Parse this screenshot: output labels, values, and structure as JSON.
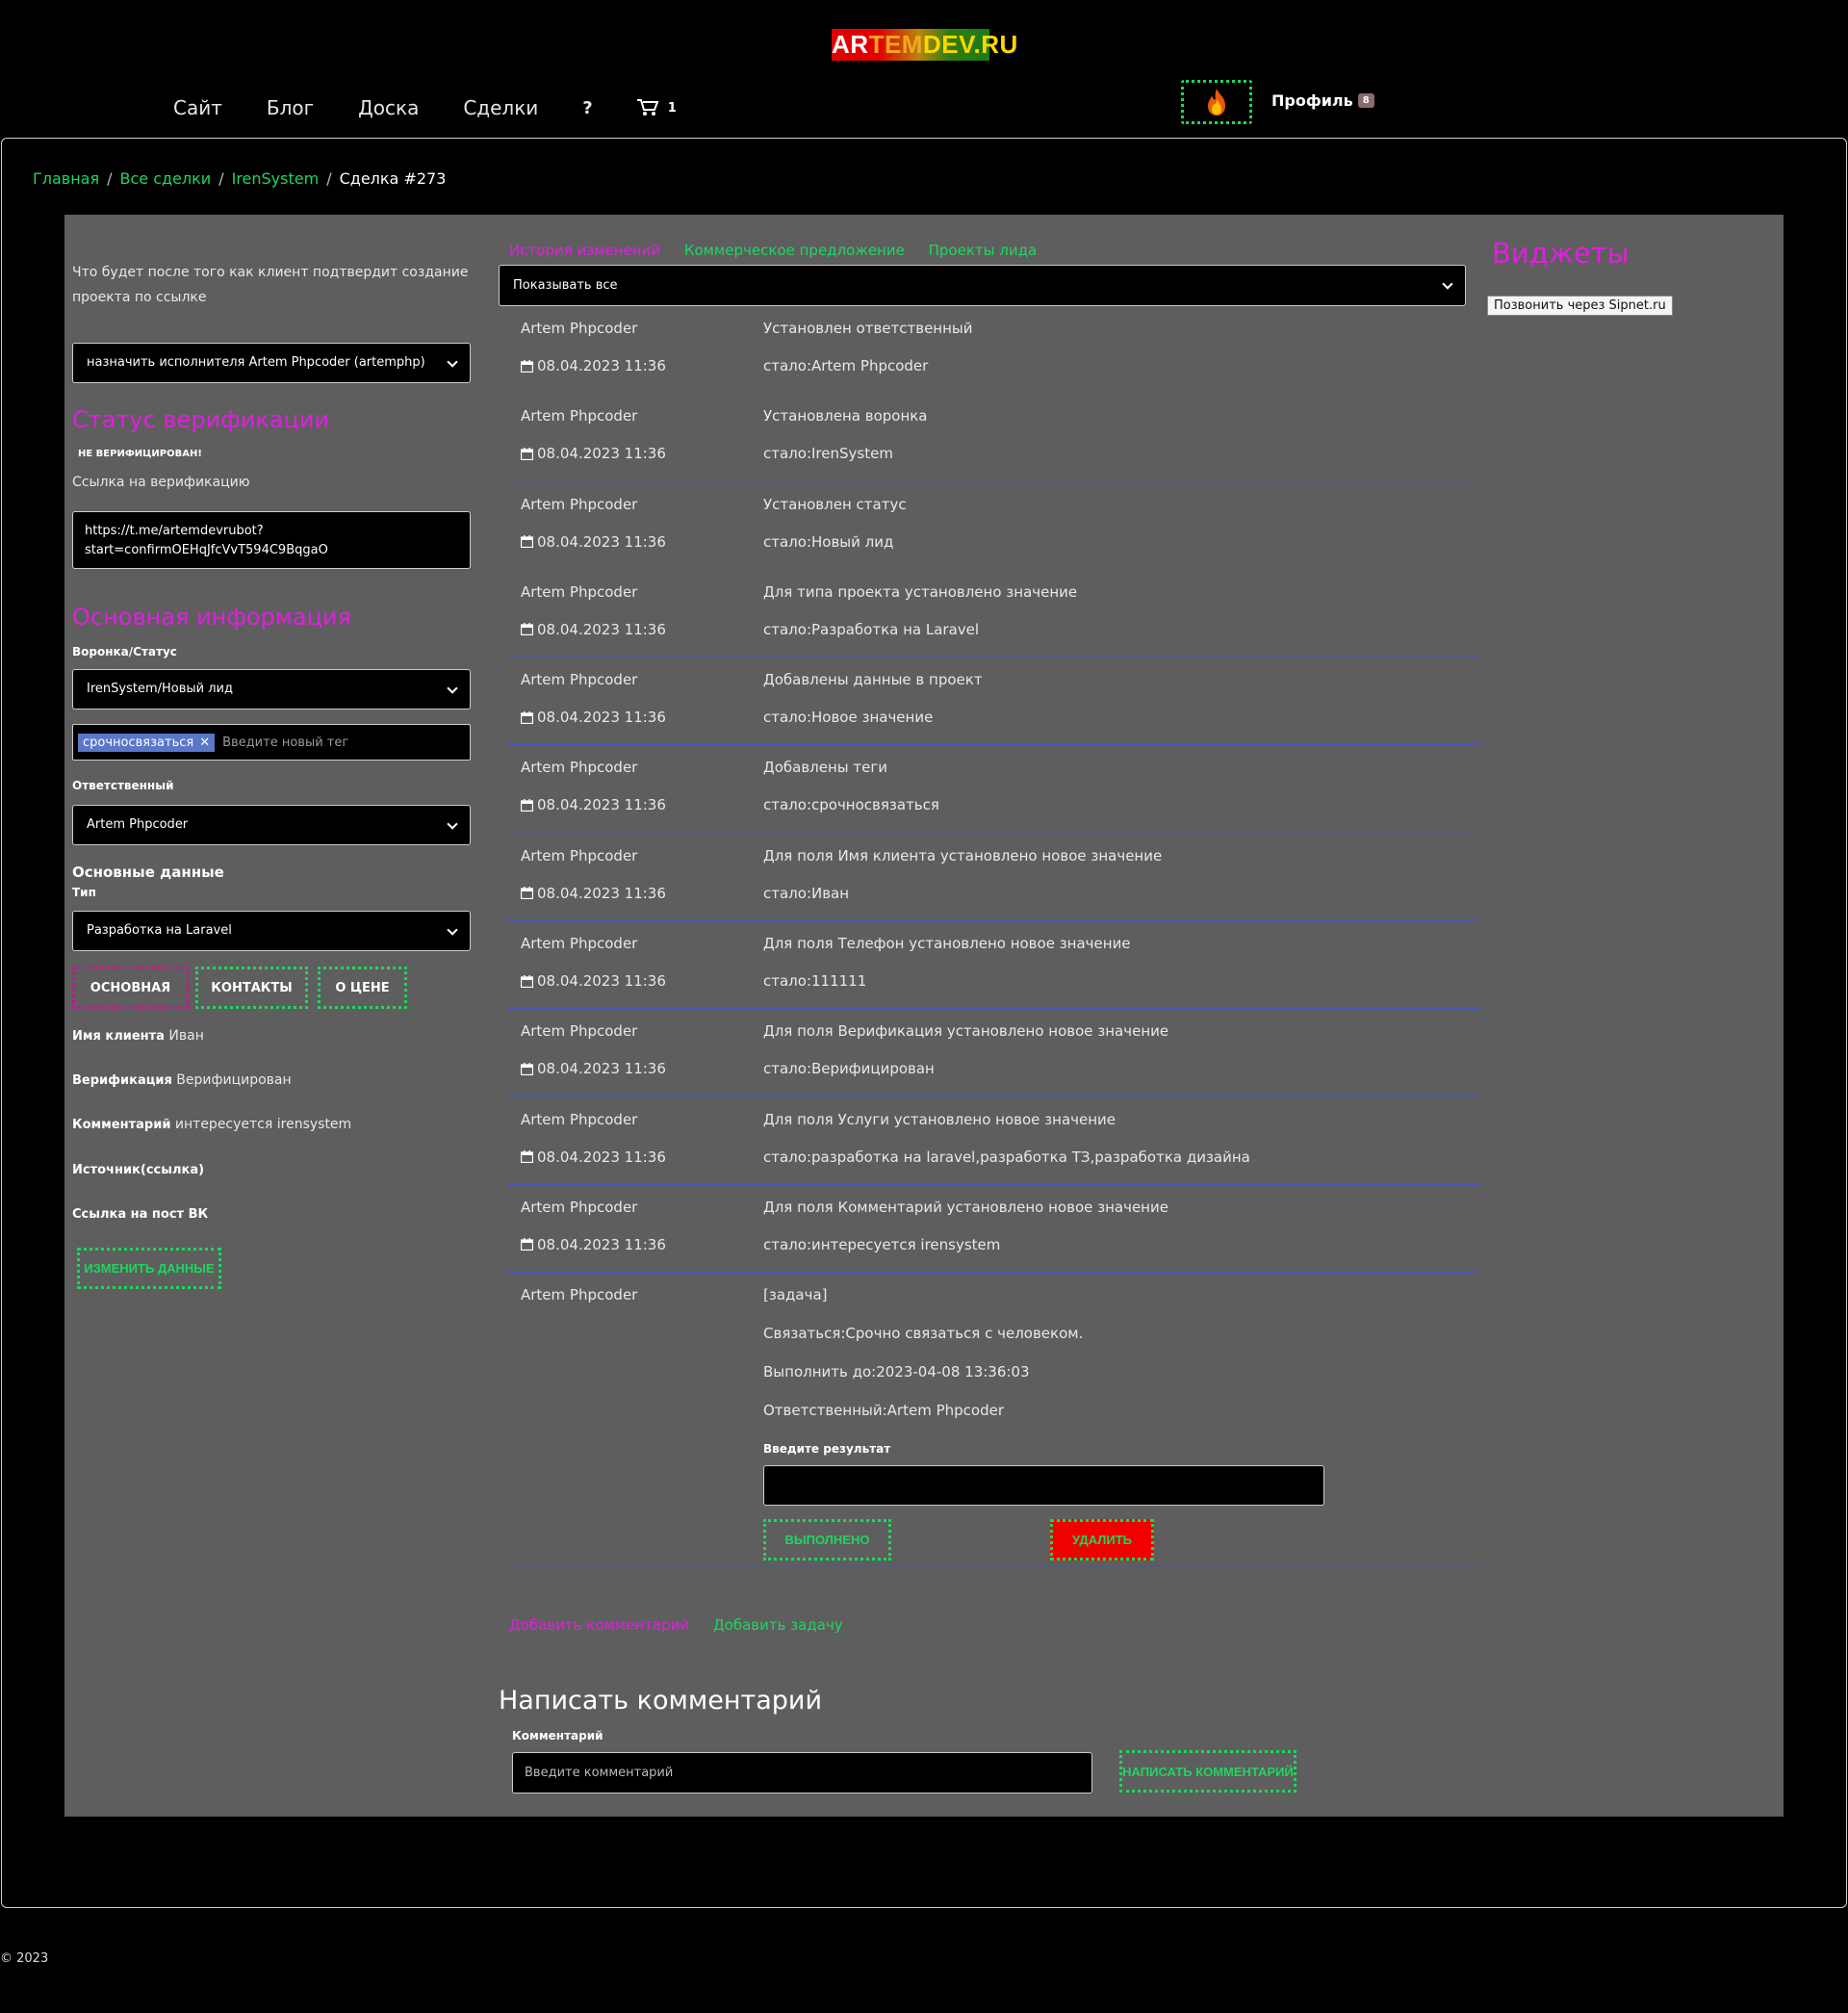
{
  "brand": {
    "p1": "AR",
    "p2": "TEM",
    "p3": "DEV",
    "p4": ".RU"
  },
  "nav": {
    "items": [
      "Сайт",
      "Блог",
      "Доска",
      "Сделки"
    ],
    "help": "?",
    "cart_count": "1",
    "profile": "Профиль",
    "profile_badge": "8"
  },
  "breadcrumb": [
    "Главная",
    "Все сделки",
    "IrenSystem",
    "Сделка #273"
  ],
  "left": {
    "desc": "Что будет после того как клиент подтвердит создание проекта по ссылке",
    "assign_select": "назначить исполнителя Artem Phpcoder (artemphp)",
    "verif_title": "Статус верификации",
    "verif_status": "НЕ ВЕРИФИЦИРОВАН!",
    "verif_link_label": "Ссылка на верификацию",
    "verif_link": "https://t.me/artemdevrubot?start=confirmOEHqJfcVvT594C9BqgaO",
    "main_info_title": "Основная информация",
    "funnel_label": "Воронка/Статус",
    "funnel_value": "IrenSystem/Новый лид",
    "tag": "срочносвязаться",
    "tag_placeholder": "Введите новый тег",
    "resp_label": "Ответственный",
    "resp_value": "Artem Phpcoder",
    "basic_data": "Основные данные",
    "type_label": "Тип",
    "type_value": "Разработка на Laravel",
    "tabs": [
      "ОСНОВНАЯ",
      "КОНТАКТЫ",
      "О ЦЕНЕ"
    ],
    "fields": [
      {
        "k": "Имя клиента",
        "v": "Иван"
      },
      {
        "k": "Верификация",
        "v": "Верифицирован"
      },
      {
        "k": "Комментарий",
        "v": "интересуется irensystem"
      },
      {
        "k": "Источник(ссылка)",
        "v": ""
      },
      {
        "k": "Ссылка на пост ВК",
        "v": ""
      }
    ],
    "edit_btn": "ИЗМЕНИТЬ ДАННЫЕ"
  },
  "middle": {
    "tabs": [
      "История изменений",
      "Коммерческое предложение",
      "Проекты лида"
    ],
    "filter": "Показывать все",
    "history": [
      {
        "who": "Artem Phpcoder",
        "date": "08.04.2023 11:36",
        "what": "Установлен ответственный",
        "val": "стало:Artem Phpcoder"
      },
      {
        "who": "Artem Phpcoder",
        "date": "08.04.2023 11:36",
        "what": "Установлена воронка",
        "val": "стало:IrenSystem"
      },
      {
        "who": "Artem Phpcoder",
        "date": "08.04.2023 11:36",
        "what": "Установлен статус",
        "val": "стало:Новый лид"
      },
      {
        "who": "Artem Phpcoder",
        "date": "08.04.2023 11:36",
        "what": "Для типа проекта установлено значение",
        "val": "стало:Разработка на Laravel"
      },
      {
        "who": "Artem Phpcoder",
        "date": "08.04.2023 11:36",
        "what": "Добавлены данные в проект",
        "val": "стало:Новое значение"
      },
      {
        "who": "Artem Phpcoder",
        "date": "08.04.2023 11:36",
        "what": "Добавлены теги",
        "val": "стало:срочносвязаться"
      },
      {
        "who": "Artem Phpcoder",
        "date": "08.04.2023 11:36",
        "what": "Для поля Имя клиента установлено новое значение",
        "val": "стало:Иван"
      },
      {
        "who": "Artem Phpcoder",
        "date": "08.04.2023 11:36",
        "what": "Для поля Телефон установлено новое значение",
        "val": "стало:111111"
      },
      {
        "who": "Artem Phpcoder",
        "date": "08.04.2023 11:36",
        "what": "Для поля Верификация установлено новое значение",
        "val": "стало:Верифицирован"
      },
      {
        "who": "Artem Phpcoder",
        "date": "08.04.2023 11:36",
        "what": "Для поля Услуги установлено новое значение",
        "val": "стало:разработка на laravel,разработка ТЗ,разработка дизайна"
      },
      {
        "who": "Artem Phpcoder",
        "date": "08.04.2023 11:36",
        "what": "Для поля Комментарий установлено новое значение",
        "val": "стало:интересуется irensystem"
      }
    ],
    "task": {
      "who": "Artem Phpcoder",
      "title": "[задача]",
      "line1": "Связаться:Срочно связаться с человеком.",
      "line2": "Выполнить до:2023-04-08 13:36:03",
      "line3": "Ответственный:Artem Phpcoder",
      "result_label": "Введите результат",
      "done_btn": "ВЫПОЛНЕНО",
      "delete_btn": "УДАЛИТЬ"
    },
    "add_comment": "Добавить комментарий",
    "add_task": "Добавить задачу",
    "write_title": "Написать комментарий",
    "comment_label": "Комментарий",
    "comment_placeholder": "Введите комментарий",
    "send_btn": "НАПИСАТЬ КОММЕНТАРИЙ"
  },
  "right": {
    "widgets_title": "Виджеты",
    "sipnet_btn": "Позвонить через Sipnet.ru"
  },
  "footer": {
    "copy": "© 2023"
  },
  "colors": {
    "accent_green": "#1fd65f",
    "accent_magenta": "#e11ee0",
    "panel": "#5e5e5e",
    "delete_red": "#f00000"
  }
}
